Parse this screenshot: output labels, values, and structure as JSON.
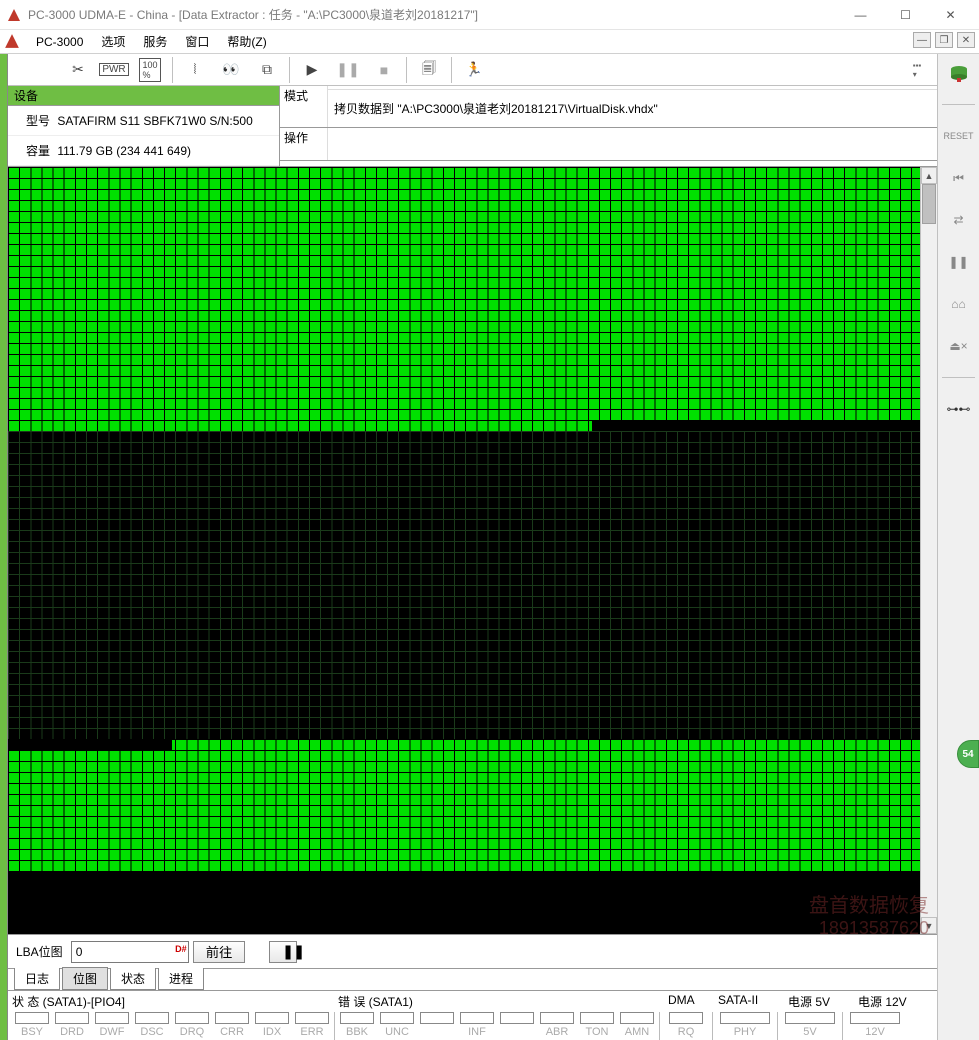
{
  "window": {
    "title": "PC-3000 UDMA-E - China - [Data Extractor : 任务 - \"A:\\PC3000\\泉道老刘20181217\"]",
    "minimize": "—",
    "maximize": "☐",
    "close": "✕"
  },
  "menubar": {
    "app": "PC-3000",
    "items": [
      "选项",
      "服务",
      "窗口",
      "帮助(Z)"
    ]
  },
  "device": {
    "header": "设备",
    "model_label": "型号",
    "model_value": "SATAFIRM   S11 SBFK71W0 S/N:500",
    "capacity_label": "容量",
    "capacity_value": "111.79 GB (234 441 649)"
  },
  "mode": {
    "header": "模式",
    "value": "拷贝数据到 \"A:\\PC3000\\泉道老刘20181217\\VirtualDisk.vhdx\""
  },
  "operation": {
    "header": "操作"
  },
  "lba": {
    "label": "LBA位图",
    "value": "0",
    "toggle": "D#",
    "go_btn": "前往",
    "pause": "❚❚"
  },
  "tabs": [
    "日志",
    "位图",
    "状态",
    "进程"
  ],
  "active_tab": 1,
  "status": {
    "state_label": "状 态 (SATA1)-[PIO4]",
    "error_label": "错 误 (SATA1)",
    "dma_label": "DMA",
    "sata2_label": "SATA-II",
    "power5_label": "电源 5V",
    "power12_label": "电源 12V",
    "state_flags": [
      "BSY",
      "DRD",
      "DWF",
      "DSC",
      "DRQ",
      "CRR",
      "IDX",
      "ERR"
    ],
    "error_flags": [
      "BBK",
      "UNC",
      "",
      "INF",
      "",
      "ABR",
      "TON",
      "AMN"
    ],
    "dma_flag": "RQ",
    "sata2_flag": "PHY",
    "p5_flag": "5V",
    "p12_flag": "12V"
  },
  "watermark": {
    "text": "盘首数据恢复",
    "phone": "18913587620"
  },
  "badge": "54"
}
